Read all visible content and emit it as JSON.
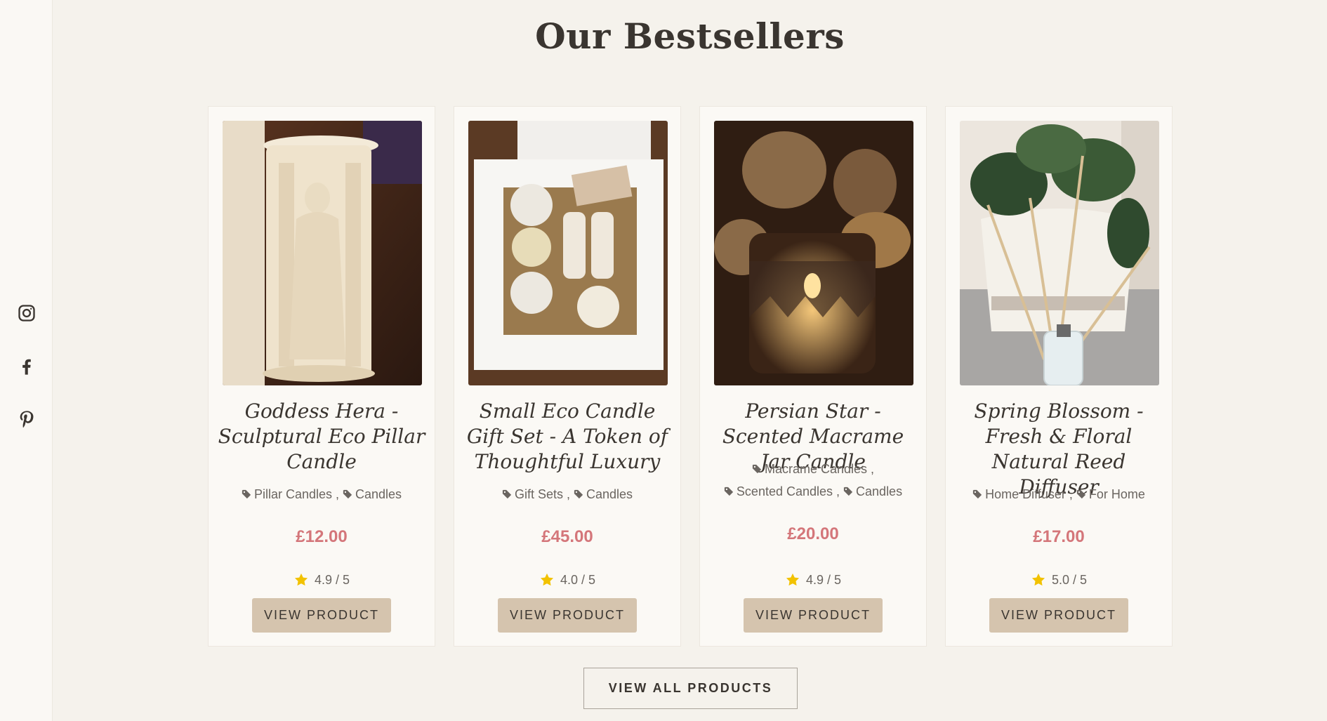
{
  "section": {
    "title": "Our Bestsellers"
  },
  "social": [
    "instagram-icon",
    "facebook-icon",
    "pinterest-icon"
  ],
  "products": [
    {
      "name": "Goddess Hera - Sculptural Eco Pillar Candle",
      "tags": [
        "Pillar Candles",
        "Candles"
      ],
      "price": "£12.00",
      "rating": "4.9 / 5",
      "button": "VIEW PRODUCT"
    },
    {
      "name": "Small Eco Candle Gift Set - A Token of Thoughtful Luxury",
      "tags": [
        "Gift Sets",
        "Candles"
      ],
      "price": "£45.00",
      "rating": "4.0 / 5",
      "button": "VIEW PRODUCT"
    },
    {
      "name": "Persian Star - Scented Macrame Jar Candle",
      "tags": [
        "Macrame Candles",
        "Scented Candles",
        "Candles"
      ],
      "price": "£20.00",
      "rating": "4.9 / 5",
      "button": "VIEW PRODUCT"
    },
    {
      "name": "Spring Blossom - Fresh & Floral Natural Reed Diffuser",
      "tags": [
        "Home Diffuser",
        "For Home"
      ],
      "price": "£17.00",
      "rating": "5.0 / 5",
      "button": "VIEW PRODUCT"
    }
  ],
  "view_all": "VIEW ALL PRODUCTS",
  "colors": {
    "background": "#f5f2ec",
    "price": "#d4767a",
    "button": "#d5c4ae",
    "star": "#f2c200",
    "text": "#3a3530"
  }
}
